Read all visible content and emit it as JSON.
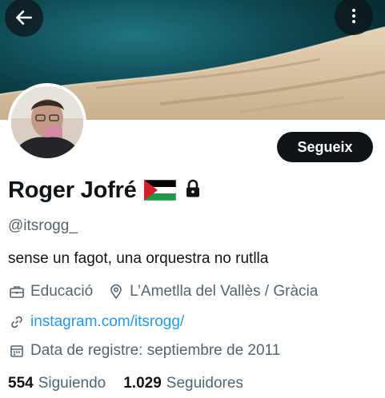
{
  "profile": {
    "name": "Roger Jofré",
    "handle": "@itsrogg_",
    "bio": "sense un fagot, una orquestra no rutlla",
    "category": "Educació",
    "location": "L’Ametlla del Vallès / Gràcia",
    "website": "instagram.com/itsrogg/",
    "joined": "Data de registre: septiembre de 2011",
    "following_count": "554",
    "following_label": "Siguiendo",
    "followers_count": "1.029",
    "followers_label": "Seguidores"
  },
  "actions": {
    "follow_label": "Segueix"
  },
  "icons": {
    "back": "back-arrow-icon",
    "more": "more-vertical-icon",
    "flag": "palestine-flag-icon",
    "lock": "lock-icon",
    "category": "briefcase-icon",
    "location": "location-pin-icon",
    "website": "link-icon",
    "joined": "calendar-icon"
  },
  "colors": {
    "text": "#0f1419",
    "secondary": "#536471",
    "link": "#1d9bf0",
    "button": "#0f1419"
  }
}
